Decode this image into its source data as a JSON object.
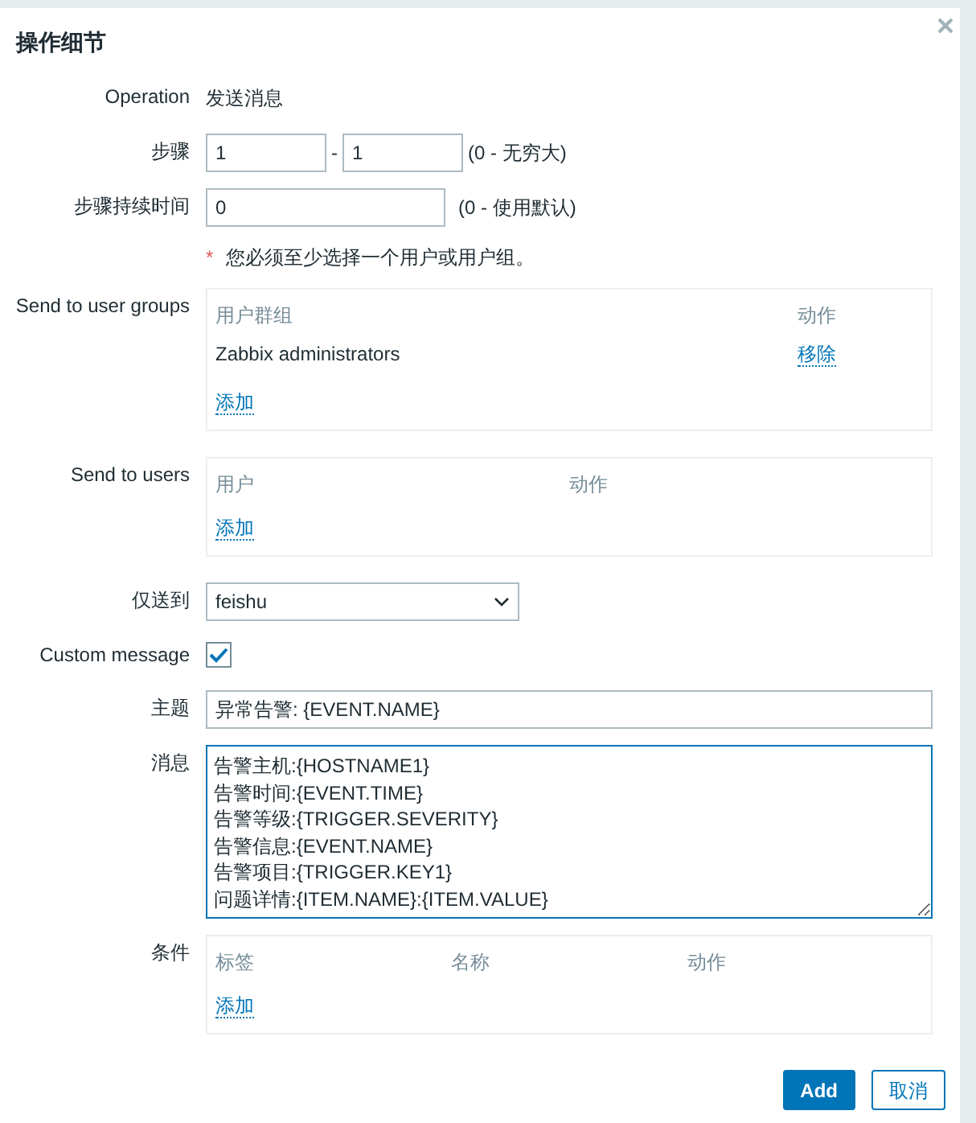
{
  "dialog": {
    "title": "操作细节"
  },
  "operation": {
    "label": "Operation",
    "value": "发送消息"
  },
  "steps": {
    "label": "步骤",
    "from": "1",
    "separator": "-",
    "to": "1",
    "hint": "(0 - 无穷大)"
  },
  "step_duration": {
    "label": "步骤持续时间",
    "value": "0",
    "hint": "(0 - 使用默认)"
  },
  "requirement": {
    "mark": "*",
    "text": "您必须至少选择一个用户或用户组。"
  },
  "user_groups": {
    "label": "Send to user groups",
    "columns": [
      "用户群组",
      "动作"
    ],
    "rows": [
      {
        "name": "Zabbix administrators",
        "action": "移除"
      }
    ],
    "add": "添加"
  },
  "users": {
    "label": "Send to users",
    "columns": [
      "用户",
      "动作"
    ],
    "add": "添加"
  },
  "send_only_to": {
    "label": "仅送到",
    "value": "feishu"
  },
  "custom_message": {
    "label": "Custom message",
    "checked": true
  },
  "subject": {
    "label": "主题",
    "value": "异常告警: {EVENT.NAME}"
  },
  "message": {
    "label": "消息",
    "value": "告警主机:{HOSTNAME1}\n告警时间:{EVENT.TIME}\n告警等级:{TRIGGER.SEVERITY}\n告警信息:{EVENT.NAME}\n告警项目:{TRIGGER.KEY1}\n问题详情:{ITEM.NAME}:{ITEM.VALUE}"
  },
  "conditions": {
    "label": "条件",
    "columns": [
      "标签",
      "名称",
      "动作"
    ],
    "add": "添加"
  },
  "buttons": [
    {
      "label": "Add",
      "kind": "primary"
    },
    {
      "label": "取消",
      "kind": "secondary"
    }
  ]
}
